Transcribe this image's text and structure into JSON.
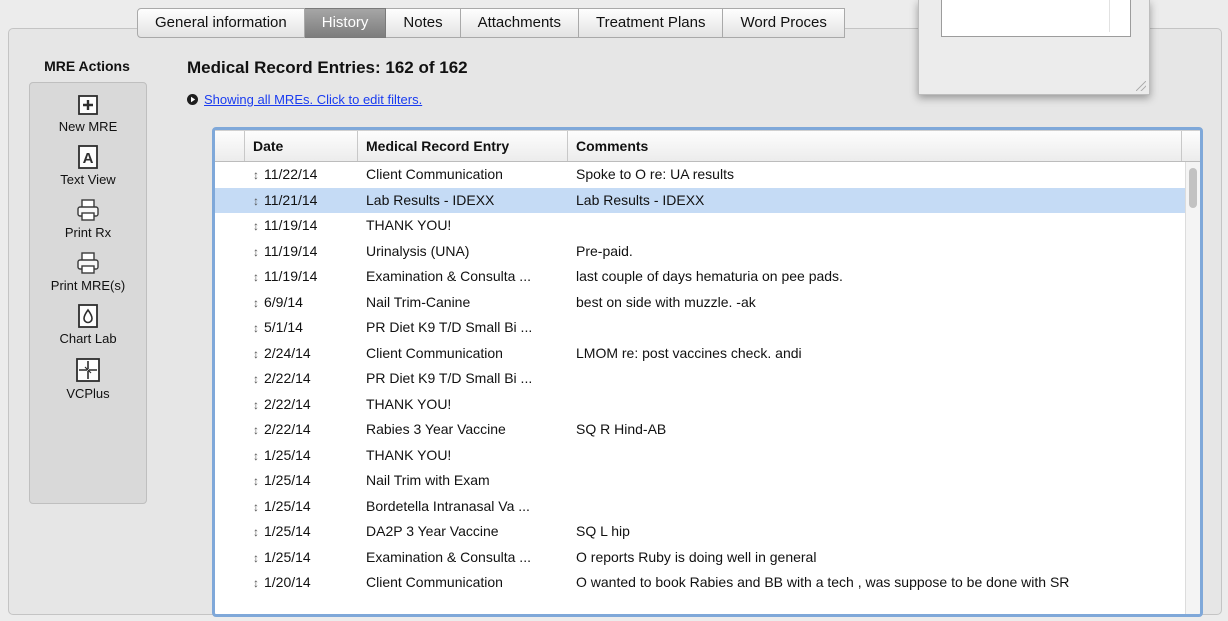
{
  "tabs": [
    {
      "label": "General information"
    },
    {
      "label": "History"
    },
    {
      "label": "Notes"
    },
    {
      "label": "Attachments"
    },
    {
      "label": "Treatment Plans"
    },
    {
      "label": "Word Proces"
    }
  ],
  "active_tab": "History",
  "sidebar": {
    "title": "MRE Actions",
    "actions": [
      {
        "label": "New MRE",
        "icon": "plus-box-icon"
      },
      {
        "label": "Text View",
        "icon": "letter-a-box-icon"
      },
      {
        "label": "Print Rx",
        "icon": "printer-icon"
      },
      {
        "label": "Print MRE(s)",
        "icon": "printer-icon"
      },
      {
        "label": "Chart Lab",
        "icon": "drop-icon"
      },
      {
        "label": "VCPlus",
        "icon": "vcplus-icon"
      }
    ]
  },
  "header": {
    "title": "Medical Record Entries: 162 of 162",
    "filter_link": "Showing all MREs. Click to edit filters."
  },
  "table": {
    "columns": [
      "Date",
      "Medical Record Entry",
      "Comments"
    ],
    "selected_index": 1,
    "rows": [
      {
        "date": "11/22/14",
        "entry": "Client Communication",
        "comment": "Spoke to O re: UA results"
      },
      {
        "date": "11/21/14",
        "entry": "Lab Results - IDEXX",
        "comment": "Lab Results - IDEXX"
      },
      {
        "date": "11/19/14",
        "entry": "THANK YOU!",
        "comment": ""
      },
      {
        "date": "11/19/14",
        "entry": "Urinalysis (UNA)",
        "comment": "Pre-paid."
      },
      {
        "date": "11/19/14",
        "entry": "Examination & Consulta ...",
        "comment": "last couple of days hematuria on pee pads."
      },
      {
        "date": "6/9/14",
        "entry": "Nail Trim-Canine",
        "comment": "best on side with muzzle. -ak"
      },
      {
        "date": "5/1/14",
        "entry": "PR Diet K9 T/D Small Bi ...",
        "comment": ""
      },
      {
        "date": "2/24/14",
        "entry": "Client Communication",
        "comment": "LMOM re: post vaccines check.  andi"
      },
      {
        "date": "2/22/14",
        "entry": "PR Diet K9 T/D Small Bi ...",
        "comment": ""
      },
      {
        "date": "2/22/14",
        "entry": "THANK YOU!",
        "comment": ""
      },
      {
        "date": "2/22/14",
        "entry": "Rabies 3 Year Vaccine",
        "comment": "SQ R Hind-AB"
      },
      {
        "date": "1/25/14",
        "entry": "THANK YOU!",
        "comment": ""
      },
      {
        "date": "1/25/14",
        "entry": "Nail Trim with Exam",
        "comment": ""
      },
      {
        "date": "1/25/14",
        "entry": "Bordetella Intranasal Va ...",
        "comment": ""
      },
      {
        "date": "1/25/14",
        "entry": "DA2P 3 Year Vaccine",
        "comment": "SQ L hip"
      },
      {
        "date": "1/25/14",
        "entry": "Examination & Consulta ...",
        "comment": "O reports Ruby is doing well in general"
      },
      {
        "date": "1/20/14",
        "entry": "Client Communication",
        "comment": "O wanted to book Rabies and BB with a tech , was suppose to be done with SR"
      }
    ]
  },
  "colors": {
    "selected_row": "#c5dbf5",
    "link": "#1a3cf0",
    "focus_ring": "#7fa8d9"
  }
}
